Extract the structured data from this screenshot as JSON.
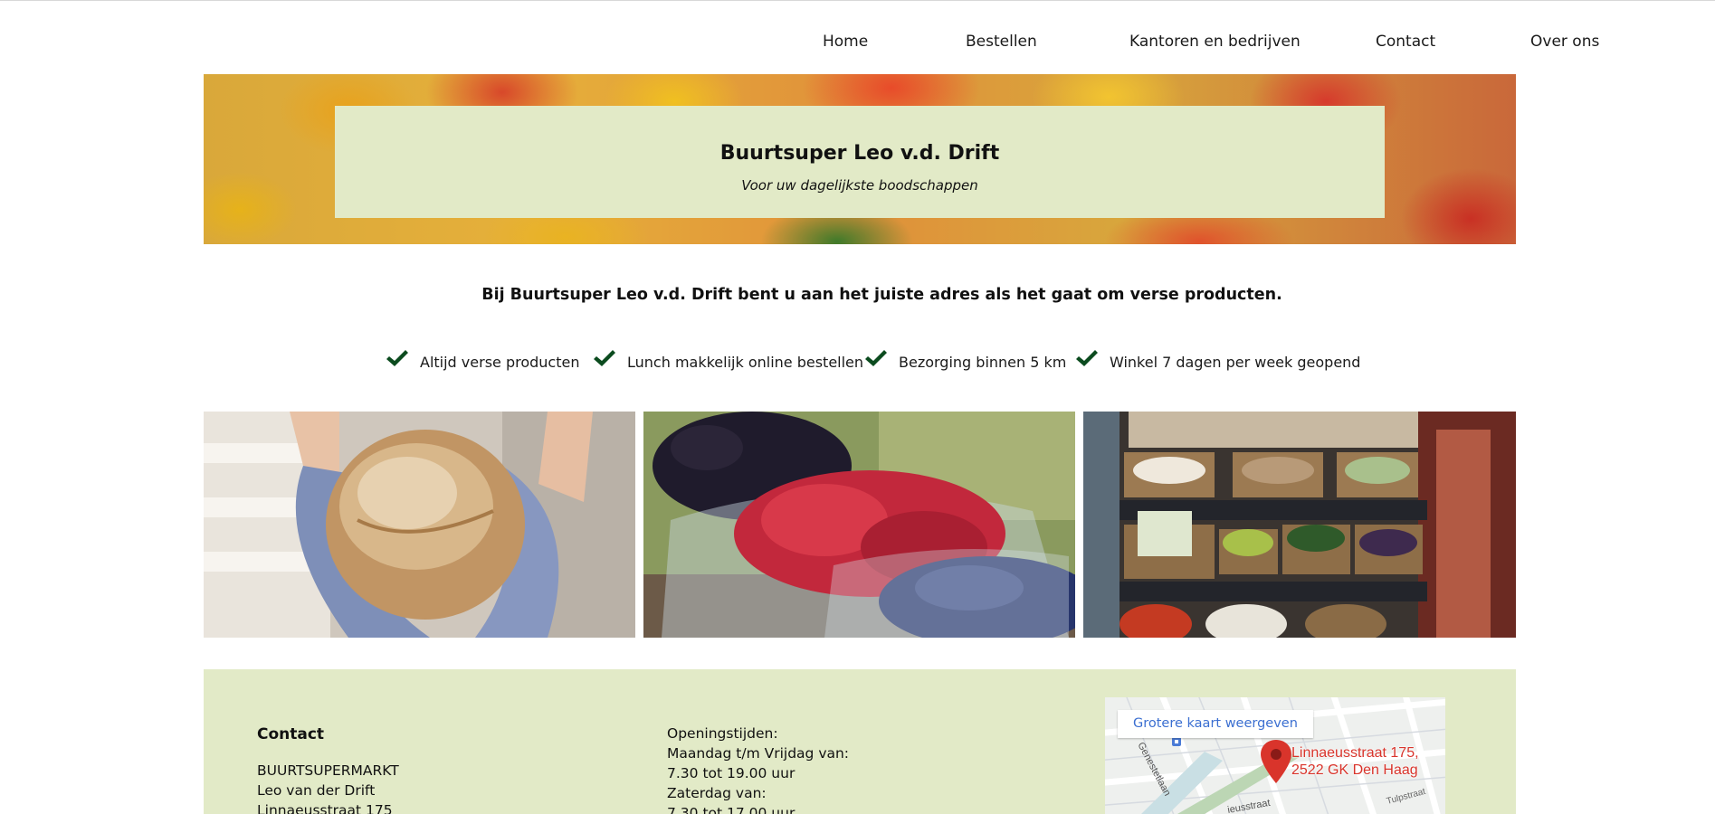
{
  "nav": {
    "items": [
      "Home",
      "Bestellen",
      "Kantoren en bedrijven",
      "Contact",
      "Over ons"
    ]
  },
  "hero": {
    "title": "Buurtsuper Leo v.d. Drift",
    "subtitle": "Voor uw dagelijkste boodschappen"
  },
  "intro": "Bij Buurtsuper Leo v.d. Drift bent u aan het juiste adres als het gaat om verse producten.",
  "features": [
    "Altijd verse producten",
    "Lunch makkelijk online bestellen",
    "Bezorging binnen 5 km",
    "Winkel 7 dagen per week geopend"
  ],
  "colors": {
    "accent_green": "#0b4b1e",
    "panel_green": "#e2eac7",
    "map_link": "#3b6fd1",
    "map_marker": "#d9342b"
  },
  "photos": [
    {
      "icon": "bread-photo"
    },
    {
      "icon": "berries-photo"
    },
    {
      "icon": "vegetable-shelf-photo"
    }
  ],
  "footer": {
    "contact_heading": "Contact",
    "contact_lines": [
      "BUURTSUPERMARKT",
      "Leo van der Drift",
      "Linnaeusstraat 175"
    ],
    "hours_lines": [
      "Openingstijden:",
      "Maandag t/m Vrijdag van:",
      "7.30 tot 19.00 uur",
      "Zaterdag van:",
      "7.30 tot 17.00 uur"
    ],
    "map": {
      "button": "Grotere kaart weergeven",
      "address_line1": "Linnaeusstraat 175,",
      "address_line2": "2522 GK Den Haag",
      "street_labels": [
        "Genestetlaan",
        "Tulpstraat",
        "ieusstraat"
      ]
    }
  }
}
